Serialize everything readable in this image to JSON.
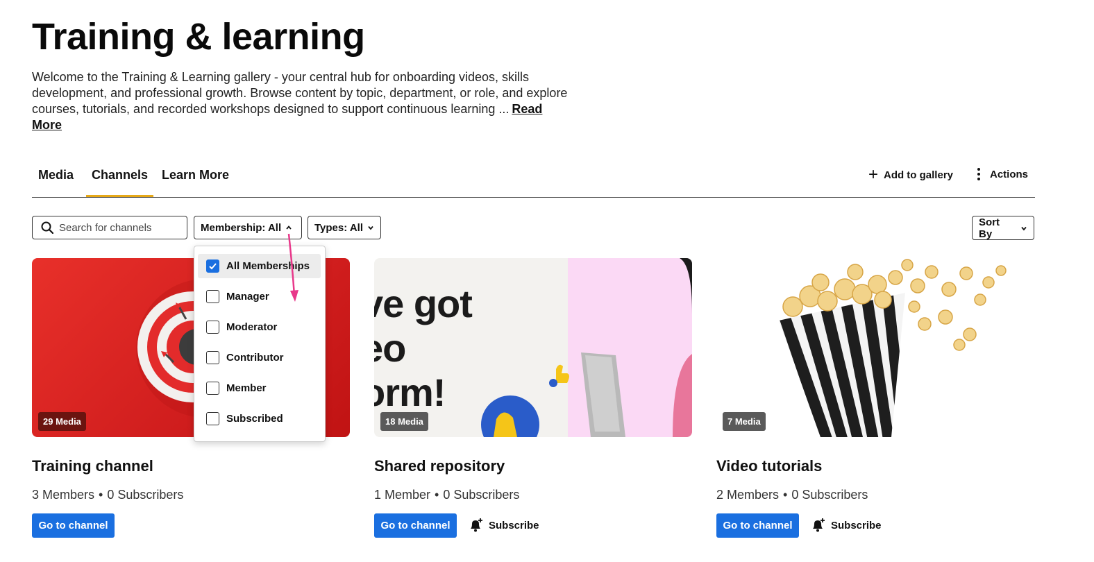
{
  "header": {
    "title": "Training & learning",
    "description": "Welcome to the Training & Learning gallery - your central hub for onboarding videos, skills development, and professional growth. Browse content by topic, department, or role, and explore courses, tutorials, and recorded workshops designed to support continuous learning ...",
    "read_more": "Read More"
  },
  "tabs": [
    {
      "label": "Media",
      "active": false
    },
    {
      "label": "Channels",
      "active": true
    },
    {
      "label": "Learn More",
      "active": false
    }
  ],
  "toolbar": {
    "add_to_gallery": "Add to gallery",
    "actions": "Actions"
  },
  "filters": {
    "search_placeholder": "Search for channels",
    "membership": "Membership: All",
    "types": "Types: All",
    "sort_by": "Sort By"
  },
  "membership_dropdown": {
    "options": [
      {
        "label": "All Memberships",
        "checked": true
      },
      {
        "label": "Manager",
        "checked": false
      },
      {
        "label": "Moderator",
        "checked": false
      },
      {
        "label": "Contributor",
        "checked": false
      },
      {
        "label": "Member",
        "checked": false
      },
      {
        "label": "Subscribed",
        "checked": false
      }
    ]
  },
  "channels": [
    {
      "badge": "29 Media",
      "title": "Training channel",
      "members": "3 Members",
      "subscribers": "0 Subscribers",
      "go_label": "Go to channel",
      "subscribe_label": ""
    },
    {
      "badge": "18 Media",
      "title": "Shared repository",
      "members": "1 Member",
      "subscribers": "0 Subscribers",
      "go_label": "Go to channel",
      "subscribe_label": "Subscribe",
      "thumb_text": [
        "ve got",
        "eo",
        "orm!"
      ]
    },
    {
      "badge": "7 Media",
      "title": "Video tutorials",
      "members": "2 Members",
      "subscribers": "0 Subscribers",
      "go_label": "Go to channel",
      "subscribe_label": "Subscribe"
    }
  ],
  "colors": {
    "accent_tab": "#e6a817",
    "primary_button": "#1a6fe0",
    "annotation_arrow": "#e8388a"
  },
  "separator": "•"
}
